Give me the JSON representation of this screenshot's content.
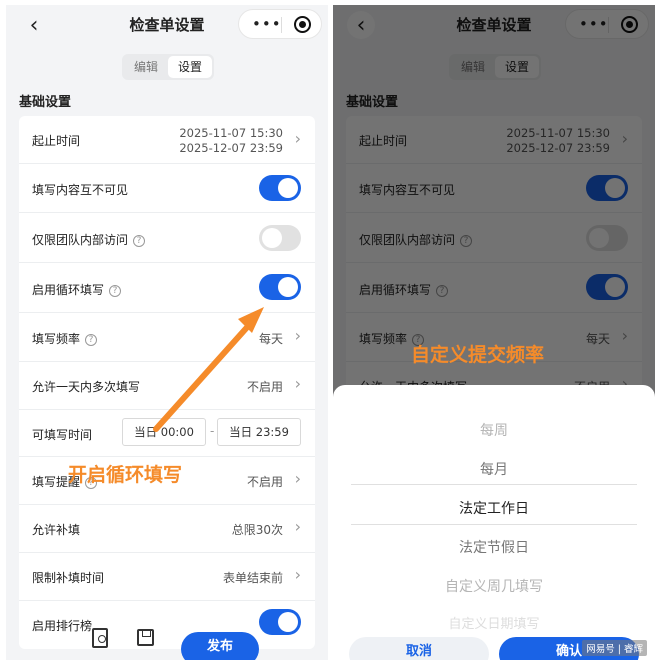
{
  "colors": {
    "accent": "#1a63e6",
    "annotation": "#f58b2a",
    "toggle_off": "#e1e1e1"
  },
  "nav": {
    "title": "检查单设置",
    "more_icon": "ellipsis-icon",
    "target_icon": "target-icon",
    "more_glyph": "•••",
    "back_glyph": "‹"
  },
  "tabs": [
    {
      "label": "编辑",
      "active": false
    },
    {
      "label": "设置",
      "active": true
    }
  ],
  "section_title": "基础设置",
  "settings": {
    "period": {
      "label": "起止时间",
      "start": "2025-11-07 15:30",
      "end": "2025-12-07 23:59"
    },
    "invisible": {
      "label": "填写内容互不可见",
      "on": true
    },
    "team_only": {
      "label": "仅限团队内部访问",
      "on": false
    },
    "loop": {
      "label": "启用循环填写",
      "on": true
    },
    "frequency": {
      "label": "填写频率",
      "value": "每天"
    },
    "multi_daily": {
      "label": "允许一天内多次填写",
      "value": "不启用"
    },
    "fill_time": {
      "label": "可填写时间",
      "start": "当日 00:00",
      "end": "当日 23:59",
      "sep": "-"
    },
    "reminder": {
      "label": "填写提醒",
      "value": "不启用"
    },
    "makeup": {
      "label": "允许补填",
      "value": "总限30次"
    },
    "makeup_limit": {
      "label": "限制补填时间",
      "value": "表单结束前"
    },
    "ranking": {
      "label": "启用排行榜",
      "on": true
    }
  },
  "bottom": {
    "publish_label": "发布"
  },
  "annotations": {
    "left": "开启循环填写",
    "right": "自定义提交频率"
  },
  "picker": {
    "options": [
      "每周",
      "每月",
      "法定工作日",
      "法定节假日",
      "自定义周几填写",
      "自定义日期填写"
    ],
    "selected_index": 2,
    "cancel_label": "取消",
    "confirm_label": "确认"
  },
  "watermark": "网易号 | 睿辉",
  "help_glyph": "?",
  "chevron_glyph": "›"
}
